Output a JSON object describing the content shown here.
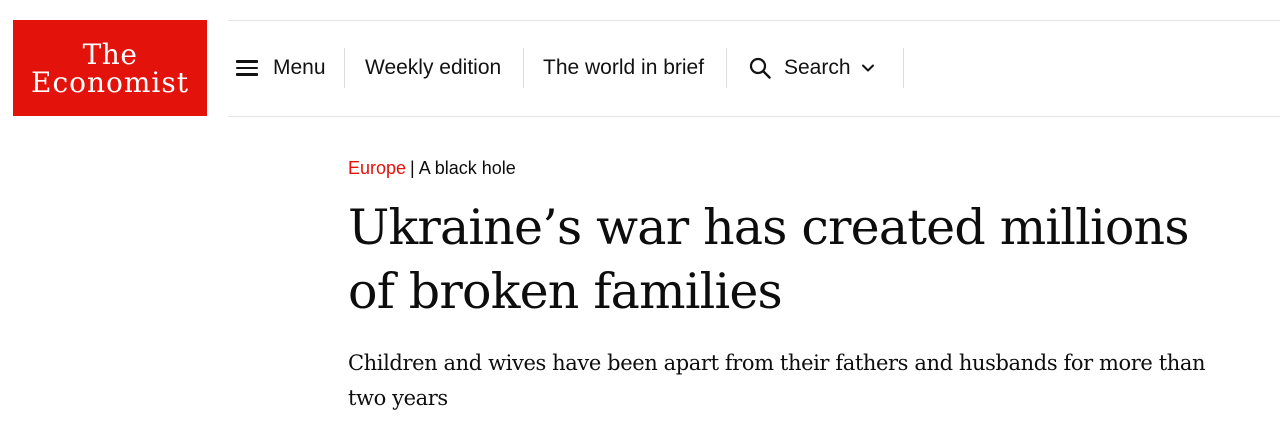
{
  "brand": {
    "logo_line1": "The",
    "logo_line2": "Economist",
    "color": "#e3120b"
  },
  "nav": {
    "menu_icon": "hamburger-icon",
    "menu_label": "Menu",
    "weekly_label": "Weekly edition",
    "brief_label": "The world in brief",
    "search_icon": "search-icon",
    "search_label": "Search",
    "search_chevron": "chevron-down-icon"
  },
  "article": {
    "section": "Europe",
    "separator": "|",
    "rubric": "A black hole",
    "headline_line1": "Ukraine’s war has created millions",
    "headline_line2": "of broken families",
    "subheadline": "Children and wives have been apart from their fathers and husbands for more than two years"
  }
}
